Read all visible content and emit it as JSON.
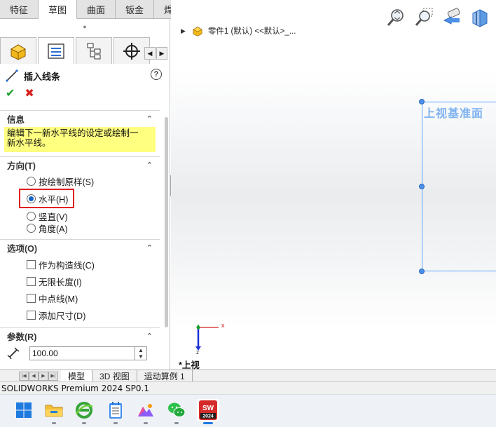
{
  "command_tabs": [
    "特征",
    "草图",
    "曲面",
    "钣金",
    "焊件"
  ],
  "active_command_tab": 1,
  "feature_tree": {
    "root_label": "零件1 (默认) <<默认>_..."
  },
  "property_manager": {
    "title": "插入线条",
    "help_glyph": "?",
    "ok_glyph": "✔",
    "cancel_glyph": "✖",
    "info": {
      "heading": "信息",
      "text_line1": "编辑下一新水平线的设定或绘制一",
      "text_line2": "新水平线。"
    },
    "direction": {
      "heading": "方向(T)",
      "options": [
        "按绘制原样(S)",
        "水平(H)",
        "竖直(V)",
        "角度(A)"
      ],
      "selected": "水平(H)"
    },
    "options": {
      "heading": "选项(O)",
      "items": [
        "作为构造线(C)",
        "无限长度(I)",
        "中点线(M)",
        "添加尺寸(D)"
      ]
    },
    "parameters": {
      "heading": "参数(R)",
      "value": "100.00"
    }
  },
  "graphics": {
    "plane_label": "上视基准面",
    "view_label": "*上视",
    "triad": {
      "x": "x",
      "z": "z"
    }
  },
  "bottom_tabs": [
    "模型",
    "3D 视图",
    "运动算例 1"
  ],
  "active_bottom_tab": 0,
  "status_bar": "SOLIDWORKS Premium 2024 SP0.1",
  "taskbar": {
    "icons": [
      "windows-start-icon",
      "file-explorer-icon",
      "browser-icon",
      "notepad-icon",
      "image-app-icon",
      "wechat-icon",
      "solidworks-icon"
    ],
    "solidworks_year": "2024",
    "solidworks_badge": "SW"
  },
  "colors": {
    "selection_blue": "#5aa2ff",
    "info_yellow": "#ffff80",
    "highlight_red": "#e02020"
  }
}
